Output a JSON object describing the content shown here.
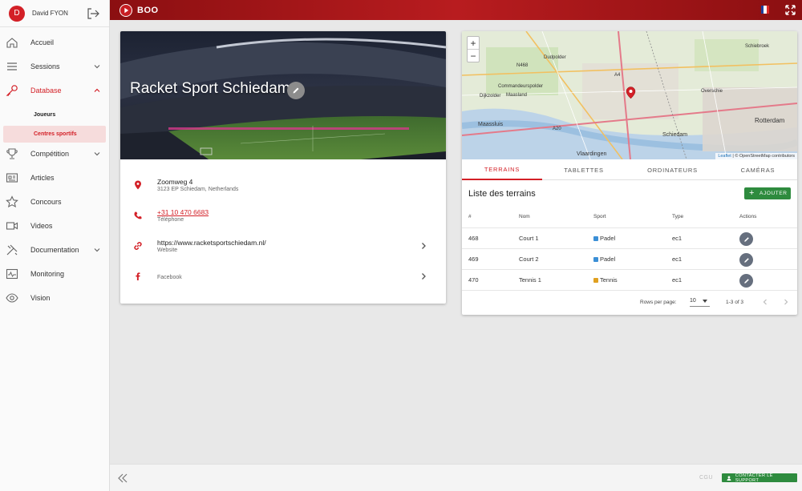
{
  "user": {
    "initial": "D",
    "name": "David FYON"
  },
  "app": {
    "name": "BOO"
  },
  "sidebar": {
    "items": [
      {
        "label": "Accueil",
        "icon": "home-icon",
        "expandable": false
      },
      {
        "label": "Sessions",
        "icon": "list-icon",
        "expandable": true
      },
      {
        "label": "Database",
        "icon": "key-icon",
        "expandable": true,
        "expanded": true
      },
      {
        "label": "Compétition",
        "icon": "trophy-icon",
        "expandable": true
      },
      {
        "label": "Articles",
        "icon": "newspaper-icon",
        "expandable": false
      },
      {
        "label": "Concours",
        "icon": "star-icon",
        "expandable": false
      },
      {
        "label": "Videos",
        "icon": "video-icon",
        "expandable": false
      },
      {
        "label": "Documentation",
        "icon": "tools-icon",
        "expandable": true
      },
      {
        "label": "Monitoring",
        "icon": "monitor-icon",
        "expandable": false
      },
      {
        "label": "Vision",
        "icon": "eye-icon",
        "expandable": false
      }
    ],
    "database_sub": [
      "Joueurs",
      "Centres sportifs"
    ]
  },
  "venue": {
    "name": "Racket Sport Schiedam",
    "address_line1": "Zoomweg 4",
    "address_line2": "3123 EP Schiedam, Netherlands",
    "phone": "+31 10 470 6683",
    "phone_label": "Téléphone",
    "website": "https://www.racketsportschiedam.nl/",
    "website_label": "Website",
    "facebook_label": "Facebook"
  },
  "map": {
    "zoom_in": "+",
    "zoom_out": "−",
    "labels": [
      "Schiebroek",
      "Dudpolder",
      "N468",
      "A4",
      "Overschie",
      "Commandeurspolder",
      "Dijkzolder",
      "Maasland",
      "Rotterdam",
      "Maassluis",
      "Schiedam",
      "A20",
      "Vlaardingen"
    ],
    "attribution_leaflet": "Leaflet",
    "attribution_rest": " | © OpenStreetMap contributors"
  },
  "tabs": [
    "TERRAINS",
    "TABLETTES",
    "ORDINATEURS",
    "CAMÉRAS"
  ],
  "fields": {
    "title": "Liste des terrains",
    "add_label": "AJOUTER",
    "columns": [
      "#",
      "Nom",
      "Sport",
      "Type",
      "Actions"
    ],
    "rows": [
      {
        "id": "468",
        "name": "Court 1",
        "sport": "Padel",
        "type": "ec1"
      },
      {
        "id": "469",
        "name": "Court 2",
        "sport": "Padel",
        "type": "ec1"
      },
      {
        "id": "470",
        "name": "Tennis 1",
        "sport": "Tennis",
        "type": "ec1"
      }
    ],
    "rows_per_page_label": "Rows per page:",
    "rows_per_page": "10",
    "range": "1-3 of 3"
  },
  "footer": {
    "cgu": "CGU",
    "support": "CONTACTER LE SUPPORT"
  },
  "colors": {
    "accent": "#d32027",
    "topbar": "#a3181b",
    "success": "#2e8b3e",
    "padel": "#3b8fd6",
    "tennis": "#e0a020"
  }
}
